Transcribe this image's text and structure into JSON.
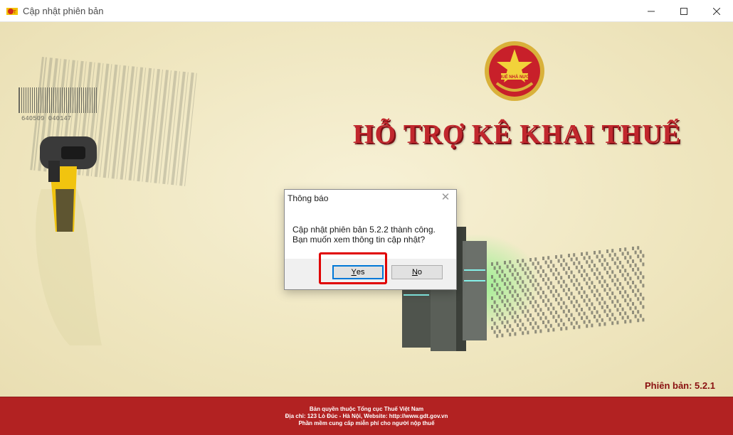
{
  "window": {
    "title": "Cập nhật phiên bản",
    "icon": "tax-app-icon",
    "controls": [
      "minimize-icon",
      "maximize-icon",
      "close-icon"
    ]
  },
  "hero": {
    "emblem_text": "THUẾ NHÀ NƯỚC",
    "title": "HỖ TRỢ KÊ KHAI THUẾ",
    "barcode_number": "640509 040147"
  },
  "version_label": "Phiên bản: 5.2.1",
  "footer": {
    "line1": "Bản quyền thuộc Tổng cục Thuế Việt Nam",
    "line2": "Địa chỉ: 123 Lò Đúc - Hà Nội, Website: http://www.gdt.gov.vn",
    "line3": "Phần mềm cung cấp miễn phí cho người nộp thuế"
  },
  "dialog": {
    "title": "Thông báo",
    "message_line1": "Cập nhật phiên bản 5.2.2 thành công.",
    "message_line2": "Bạn muốn xem thông tin cập nhật?",
    "yes_first": "Y",
    "yes_rest": "es",
    "no_first": "N",
    "no_rest": "o"
  },
  "colors": {
    "background": "#f3ecc5",
    "title_red": "#c1272d",
    "footer_red": "#b22222",
    "highlight": "#e00000"
  }
}
